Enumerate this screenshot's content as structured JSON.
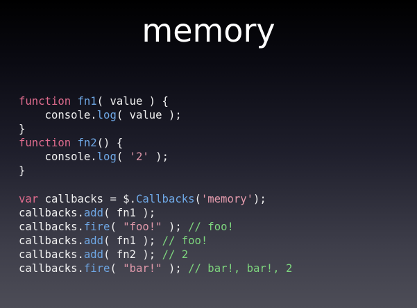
{
  "slide": {
    "title": "memory"
  },
  "code": {
    "lines": [
      [
        [
          "keyword",
          "function"
        ],
        [
          "plain",
          " "
        ],
        [
          "method",
          "fn1"
        ],
        [
          "plain",
          "( value ) {"
        ]
      ],
      [
        [
          "plain",
          "    console."
        ],
        [
          "method",
          "log"
        ],
        [
          "plain",
          "( value );"
        ]
      ],
      [
        [
          "plain",
          "}"
        ]
      ],
      [
        [
          "keyword",
          "function"
        ],
        [
          "plain",
          " "
        ],
        [
          "method",
          "fn2"
        ],
        [
          "plain",
          "() {"
        ]
      ],
      [
        [
          "plain",
          "    console."
        ],
        [
          "method",
          "log"
        ],
        [
          "plain",
          "( "
        ],
        [
          "string",
          "'2'"
        ],
        [
          "plain",
          " );"
        ]
      ],
      [
        [
          "plain",
          "}"
        ]
      ],
      [],
      [
        [
          "keyword",
          "var"
        ],
        [
          "plain",
          " callbacks = $."
        ],
        [
          "method",
          "Callbacks"
        ],
        [
          "plain",
          "("
        ],
        [
          "string",
          "'memory'"
        ],
        [
          "plain",
          ");"
        ]
      ],
      [
        [
          "plain",
          "callbacks."
        ],
        [
          "method",
          "add"
        ],
        [
          "plain",
          "( fn1 );"
        ]
      ],
      [
        [
          "plain",
          "callbacks."
        ],
        [
          "method",
          "fire"
        ],
        [
          "plain",
          "( "
        ],
        [
          "string",
          "\"foo!\""
        ],
        [
          "plain",
          " ); "
        ],
        [
          "comment",
          "// foo!"
        ]
      ],
      [
        [
          "plain",
          "callbacks."
        ],
        [
          "method",
          "add"
        ],
        [
          "plain",
          "( fn1 ); "
        ],
        [
          "comment",
          "// foo!"
        ]
      ],
      [
        [
          "plain",
          "callbacks."
        ],
        [
          "method",
          "add"
        ],
        [
          "plain",
          "( fn2 ); "
        ],
        [
          "comment",
          "// 2"
        ]
      ],
      [
        [
          "plain",
          "callbacks."
        ],
        [
          "method",
          "fire"
        ],
        [
          "plain",
          "( "
        ],
        [
          "string",
          "\"bar!\""
        ],
        [
          "plain",
          " ); "
        ],
        [
          "comment",
          "// bar!, bar!, 2"
        ]
      ]
    ]
  },
  "colors": {
    "background_top": "#000000",
    "background_bottom": "#4d4d57",
    "title": "#ffffff",
    "plain": "#f0f0f0",
    "keyword": "#e06c8e",
    "method": "#6fa8e6",
    "string": "#e39aac",
    "comment": "#7ed67e"
  }
}
